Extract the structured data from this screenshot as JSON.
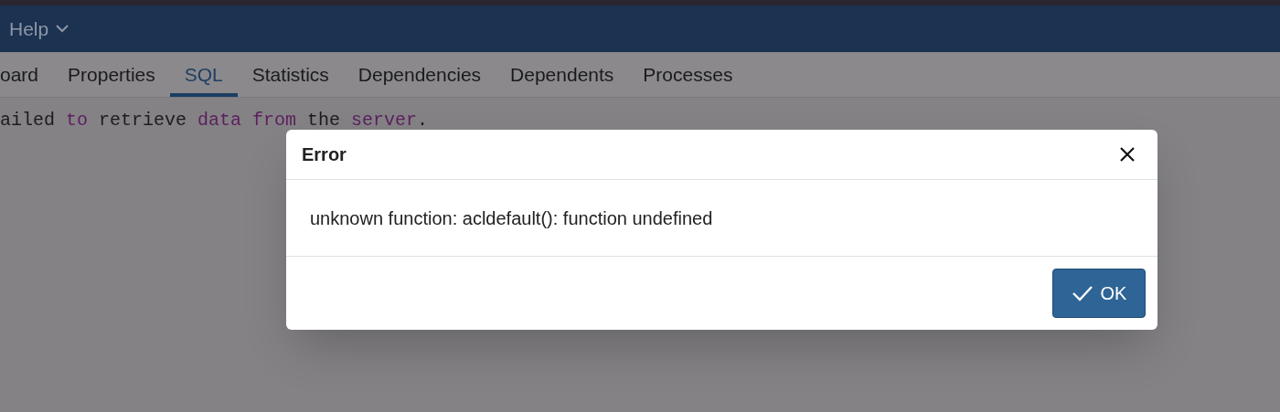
{
  "menubar": {
    "items": [
      {
        "label": "Help",
        "expanded": false
      }
    ]
  },
  "tabs": [
    {
      "label": "oard",
      "selected": false
    },
    {
      "label": "Properties",
      "selected": false
    },
    {
      "label": "SQL",
      "selected": true
    },
    {
      "label": "Statistics",
      "selected": false
    },
    {
      "label": "Dependencies",
      "selected": false
    },
    {
      "label": "Dependents",
      "selected": false
    },
    {
      "label": "Processes",
      "selected": false
    }
  ],
  "sql_output": [
    {
      "text": "ailed",
      "kind": "plain"
    },
    {
      "text": "to",
      "kind": "keyword"
    },
    {
      "text": "retrieve",
      "kind": "plain"
    },
    {
      "text": "data",
      "kind": "keyword"
    },
    {
      "text": "from",
      "kind": "keyword"
    },
    {
      "text": "the",
      "kind": "plain"
    },
    {
      "text": "server",
      "kind": "keyword"
    },
    {
      "text": ".",
      "kind": "punct"
    }
  ],
  "dialog": {
    "title": "Error",
    "message": "unknown function: acldefault(): function undefined",
    "buttons": [
      {
        "label": "OK"
      }
    ]
  }
}
